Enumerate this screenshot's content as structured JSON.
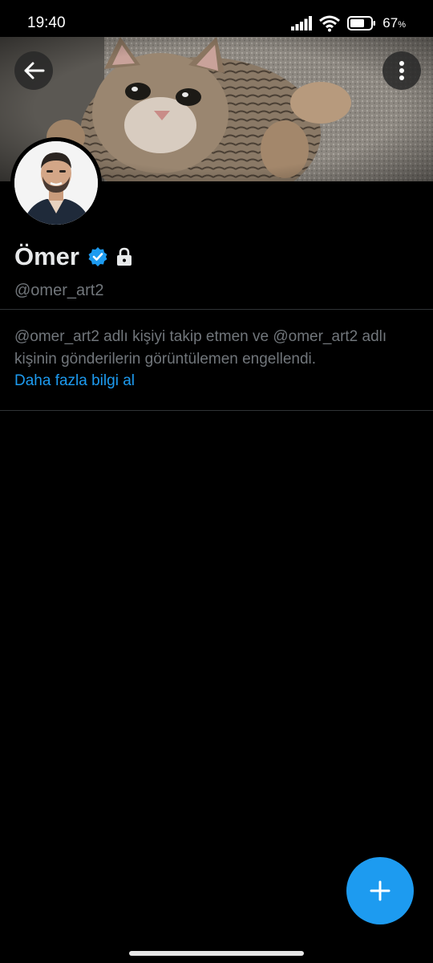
{
  "status_bar": {
    "time": "19:40",
    "battery_percent": "67",
    "battery_unit": "%",
    "icons": [
      "signal-icon",
      "wifi-icon",
      "battery-icon"
    ]
  },
  "banner": {
    "image": "cat-banner-photo",
    "back_icon": "arrow-left-icon",
    "more_icon": "more-vertical-icon"
  },
  "profile": {
    "display_name": "Ömer",
    "handle": "@omer_art2",
    "verified": true,
    "protected": true,
    "avatar": "avatar-photo"
  },
  "blocked_notice": {
    "message": "@omer_art2 adlı kişiyi takip etmen ve @omer_art2 adlı kişinin gönderilerin görüntülemen engellendi.",
    "link_label": "Daha fazla bilgi al"
  },
  "fab": {
    "icon": "plus-icon"
  },
  "colors": {
    "accent": "#1d9bf0",
    "background": "#000000",
    "secondary_text": "#71767b",
    "divider": "#2f3336"
  }
}
